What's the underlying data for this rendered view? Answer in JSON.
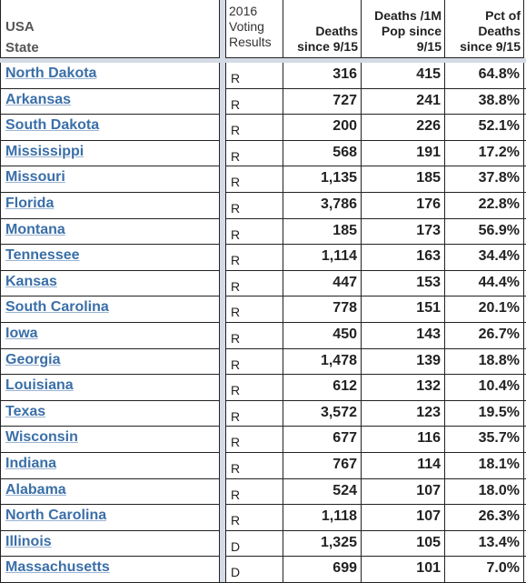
{
  "headers": {
    "state": [
      "USA",
      "State"
    ],
    "vote": [
      "2016",
      "Voting",
      "Results"
    ],
    "deaths": [
      "Deaths",
      "since 9/15"
    ],
    "per_million": [
      "Deaths /1M",
      "Pop since",
      "9/15"
    ],
    "pct": [
      "Pct of",
      "Deaths",
      "since 9/15"
    ]
  },
  "rows": [
    {
      "state": "North Dakota",
      "vote": "R",
      "deaths": "316",
      "per_million": "415",
      "pct": "64.8%"
    },
    {
      "state": "Arkansas",
      "vote": "R",
      "deaths": "727",
      "per_million": "241",
      "pct": "38.8%"
    },
    {
      "state": "South Dakota",
      "vote": "R",
      "deaths": "200",
      "per_million": "226",
      "pct": "52.1%"
    },
    {
      "state": "Mississippi",
      "vote": "R",
      "deaths": "568",
      "per_million": "191",
      "pct": "17.2%"
    },
    {
      "state": "Missouri",
      "vote": "R",
      "deaths": "1,135",
      "per_million": "185",
      "pct": "37.8%"
    },
    {
      "state": "Florida",
      "vote": "R",
      "deaths": "3,786",
      "per_million": "176",
      "pct": "22.8%"
    },
    {
      "state": "Montana",
      "vote": "R",
      "deaths": "185",
      "per_million": "173",
      "pct": "56.9%"
    },
    {
      "state": "Tennessee",
      "vote": "R",
      "deaths": "1,114",
      "per_million": "163",
      "pct": "34.4%"
    },
    {
      "state": "Kansas",
      "vote": "R",
      "deaths": "447",
      "per_million": "153",
      "pct": "44.4%"
    },
    {
      "state": "South Carolina",
      "vote": "R",
      "deaths": "778",
      "per_million": "151",
      "pct": "20.1%"
    },
    {
      "state": "Iowa",
      "vote": "R",
      "deaths": "450",
      "per_million": "143",
      "pct": "26.7%"
    },
    {
      "state": "Georgia",
      "vote": "R",
      "deaths": "1,478",
      "per_million": "139",
      "pct": "18.8%"
    },
    {
      "state": "Louisiana",
      "vote": "R",
      "deaths": "612",
      "per_million": "132",
      "pct": "10.4%"
    },
    {
      "state": "Texas",
      "vote": "R",
      "deaths": "3,572",
      "per_million": "123",
      "pct": "19.5%"
    },
    {
      "state": "Wisconsin",
      "vote": "R",
      "deaths": "677",
      "per_million": "116",
      "pct": "35.7%"
    },
    {
      "state": "Indiana",
      "vote": "R",
      "deaths": "767",
      "per_million": "114",
      "pct": "18.1%"
    },
    {
      "state": "Alabama",
      "vote": "R",
      "deaths": "524",
      "per_million": "107",
      "pct": "18.0%"
    },
    {
      "state": "North Carolina",
      "vote": "R",
      "deaths": "1,118",
      "per_million": "107",
      "pct": "26.3%"
    },
    {
      "state": "Illinois",
      "vote": "D",
      "deaths": "1,325",
      "per_million": "105",
      "pct": "13.4%"
    },
    {
      "state": "Massachusetts",
      "vote": "D",
      "deaths": "699",
      "per_million": "101",
      "pct": "7.0%"
    }
  ]
}
